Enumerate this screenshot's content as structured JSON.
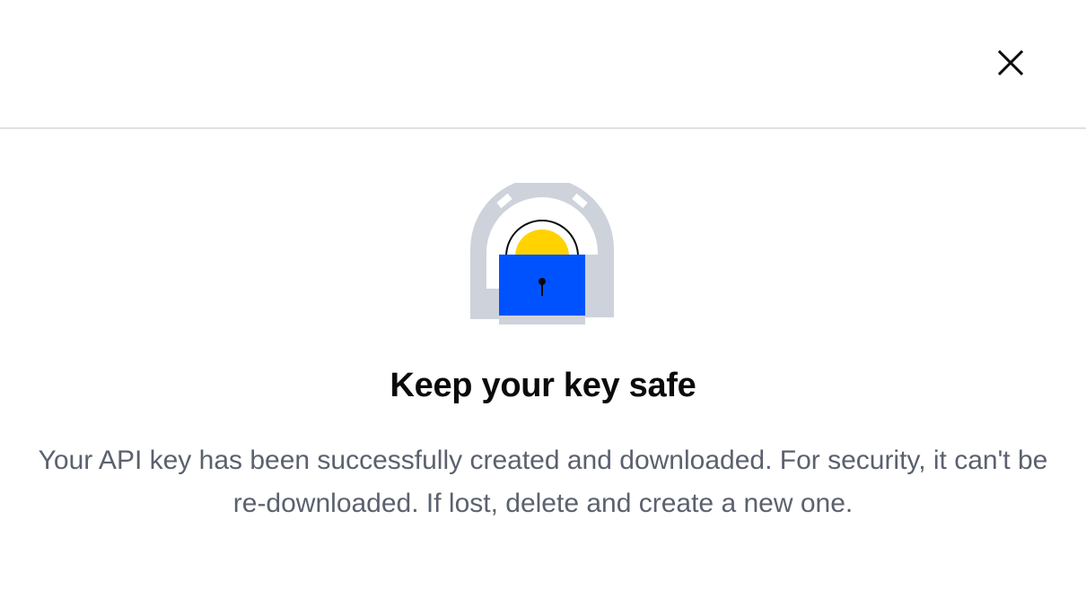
{
  "dialog": {
    "close_icon": "close-icon",
    "illustration_icon": "padlock-icon",
    "title": "Keep your key safe",
    "description": "Your API key has been successfully created and downloaded. For security, it can't be re-downloaded. If lost, delete and create a new one."
  },
  "colors": {
    "background": "#ffffff",
    "divider": "#dfe1e4",
    "title": "#0a0b0d",
    "body_text": "#5b616e",
    "lock_body": "#0052ff",
    "lock_shackle_fill": "#ffd200",
    "arch": "#ced2db"
  }
}
